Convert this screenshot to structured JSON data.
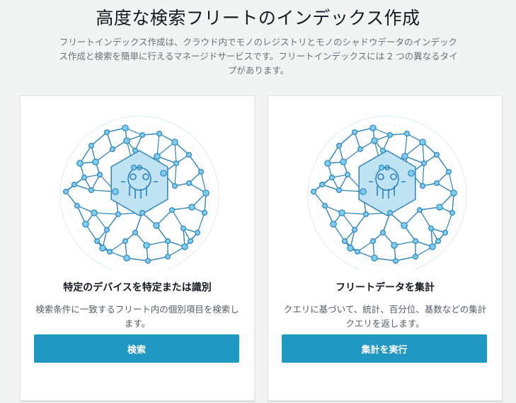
{
  "header": {
    "title": "高度な検索フリートのインデックス作成",
    "description": "フリートインデックス作成は、クラウド内でモノのレジストリとモノのシャドウデータのインデックス作成と検索を簡単に行えるマネージドサービスです。フリートインデックスには 2 つの異なるタイプがあります。"
  },
  "cards": [
    {
      "illustration_icon": "fleet-device-globe-icon",
      "title": "特定のデバイスを特定または識別",
      "description": "検索条件に一致するフリート内の個別項目を検索します。",
      "button_label": "検索"
    },
    {
      "illustration_icon": "fleet-device-globe-icon",
      "title": "フリートデータを集計",
      "description": "クエリに基づいて、統計、百分位、基数などの集計クエリを返します。",
      "button_label": "集計を実行"
    }
  ],
  "colors": {
    "accent": "#2197c4",
    "node_fill": "#7ccdf0",
    "node_stroke": "#2b84bf",
    "hexagon_fill": "#bfe3f3",
    "background": "#f2f3f3"
  }
}
